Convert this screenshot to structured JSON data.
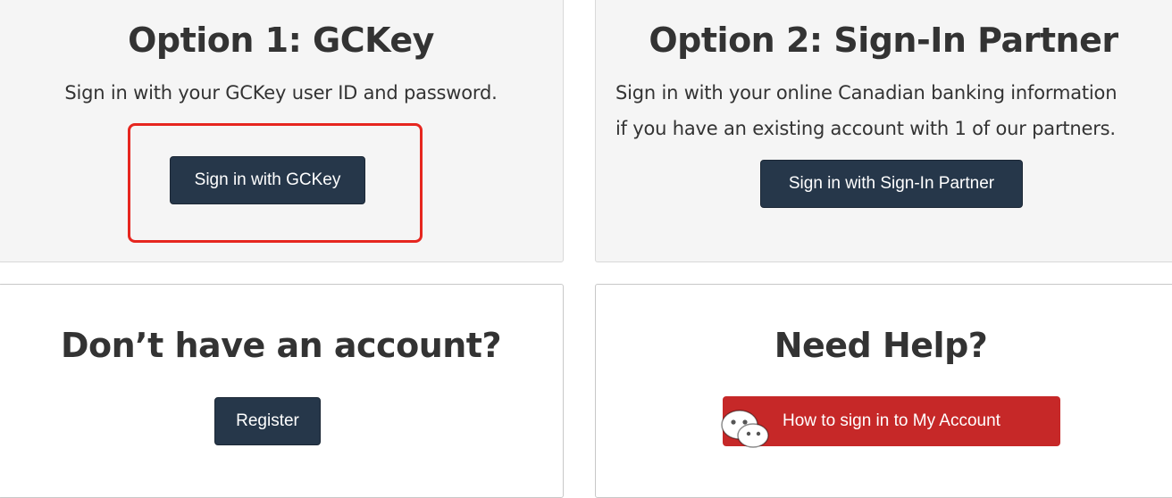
{
  "option1": {
    "heading": "Option 1: GCKey",
    "description": "Sign in with your GCKey user ID and password.",
    "button_label": "Sign in with GCKey"
  },
  "option2": {
    "heading": "Option 2: Sign-In Partner",
    "description_line1": "Sign in with your online Canadian banking information",
    "description_line2": "if you have an existing account with 1 of our partners.",
    "button_label": "Sign in with Sign-In Partner"
  },
  "register": {
    "heading": "Don’t have an account?",
    "button_label": "Register"
  },
  "help": {
    "heading": "Need Help?",
    "button_label": "How to sign in to My Account"
  },
  "watermark": {
    "icon": "wechat-icon"
  },
  "colors": {
    "button_navy": "#26374a",
    "button_red": "#c62828",
    "highlight_red": "#e6261f"
  }
}
